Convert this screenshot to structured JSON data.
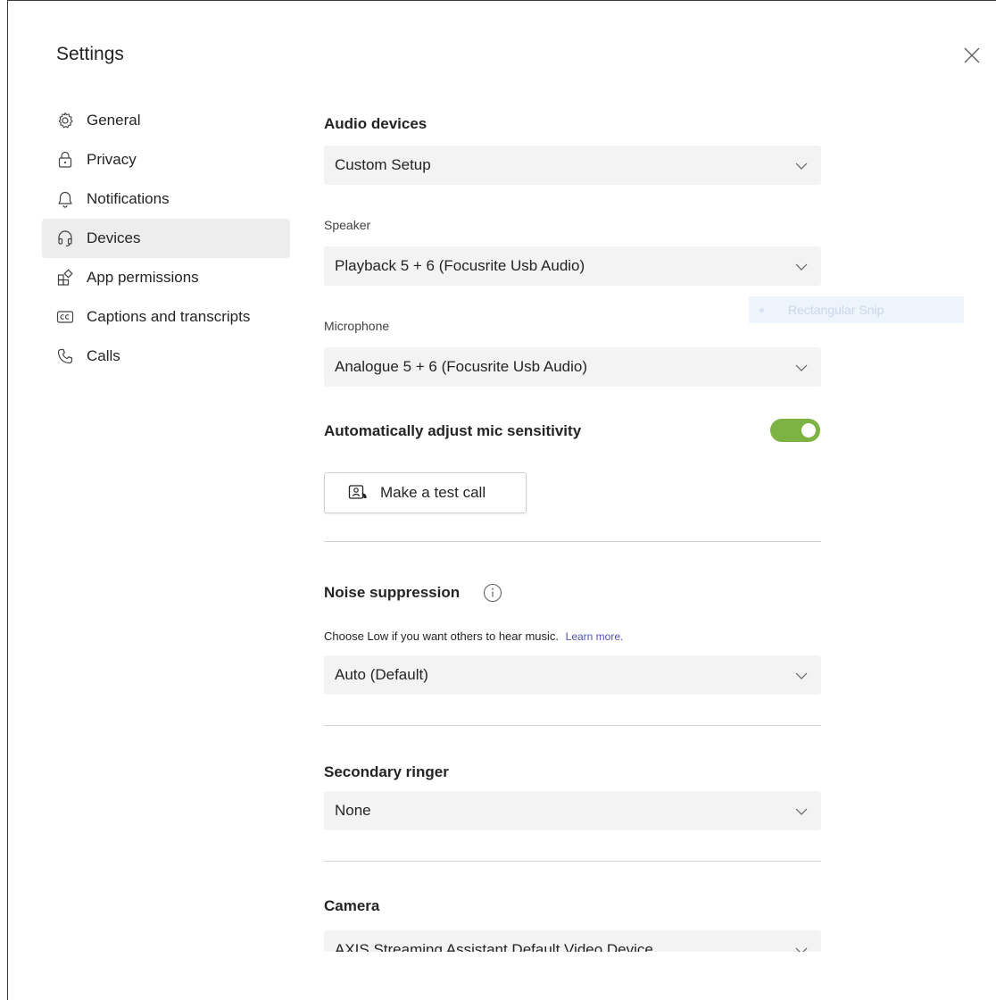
{
  "dialog": {
    "title": "Settings"
  },
  "nav": {
    "items": [
      {
        "label": "General",
        "icon": "gear-icon",
        "selected": false
      },
      {
        "label": "Privacy",
        "icon": "lock-icon",
        "selected": false
      },
      {
        "label": "Notifications",
        "icon": "bell-icon",
        "selected": false
      },
      {
        "label": "Devices",
        "icon": "headset-icon",
        "selected": true
      },
      {
        "label": "App permissions",
        "icon": "app-grid-icon",
        "selected": false
      },
      {
        "label": "Captions and transcripts",
        "icon": "closed-captions-icon",
        "selected": false
      },
      {
        "label": "Calls",
        "icon": "phone-icon",
        "selected": false
      }
    ]
  },
  "audio": {
    "heading": "Audio devices",
    "selected": "Custom Setup",
    "speaker_label": "Speaker",
    "speaker_value": "Playback 5 + 6 (Focusrite Usb Audio)",
    "microphone_label": "Microphone",
    "microphone_value": "Analogue 5 + 6 (Focusrite Usb Audio)",
    "auto_adjust_label": "Automatically adjust mic sensitivity",
    "auto_adjust_on": true,
    "test_call_label": "Make a test call"
  },
  "noise": {
    "heading": "Noise suppression",
    "description": "Choose Low if you want others to hear music.",
    "learn_more": "Learn more.",
    "value": "Auto (Default)"
  },
  "ringer": {
    "heading": "Secondary ringer",
    "value": "None"
  },
  "camera": {
    "heading": "Camera",
    "value": "AXIS Streaming Assistant Default Video Device"
  },
  "snip": {
    "label": "Rectangular Snip"
  },
  "colors": {
    "toggle_on": "#7cb342",
    "link": "#4f52b2",
    "selected_nav": "#ededed",
    "dropdown_bg": "#f3f3f3"
  }
}
